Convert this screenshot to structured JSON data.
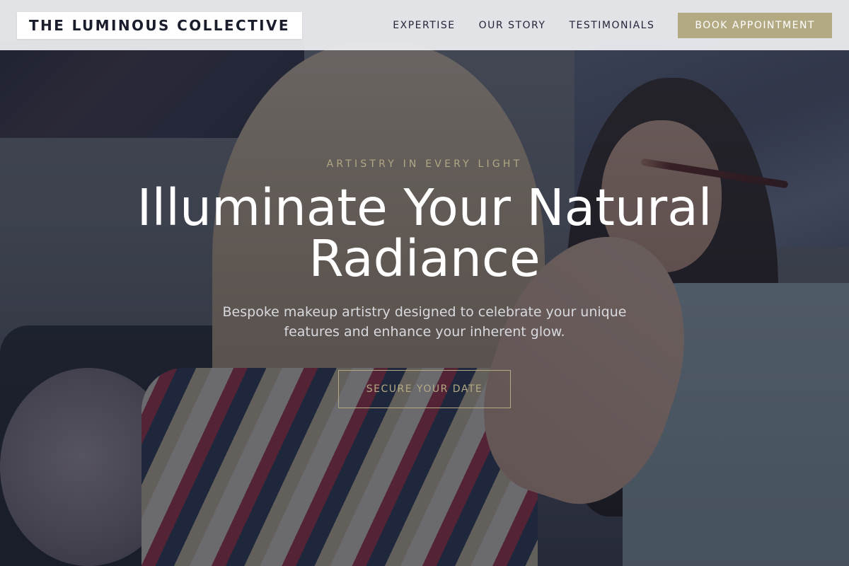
{
  "brand": {
    "name": "THE LUMINOUS COLLECTIVE"
  },
  "nav": {
    "links": [
      "EXPERTISE",
      "OUR STORY",
      "TESTIMONIALS"
    ],
    "cta_label": "BOOK APPOINTMENT"
  },
  "hero": {
    "eyebrow": "ARTISTRY IN EVERY LIGHT",
    "headline_line1": "Illuminate Your Natural",
    "headline_line2": "Radiance",
    "subhead_line1": "Bespoke makeup artistry designed to celebrate your unique",
    "subhead_line2": "features and enhance your inherent glow.",
    "cta_label": "SECURE YOUR DATE",
    "background_image": "makeup-artist-applying-eyeshadow-photo-icon"
  },
  "colors": {
    "accent": "#b3a983",
    "dark_text": "#1a1d2b",
    "overlay": "#161a2a"
  }
}
